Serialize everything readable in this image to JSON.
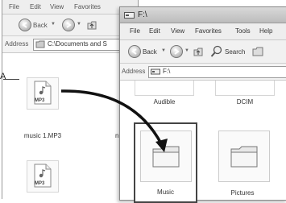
{
  "back_window": {
    "menu": [
      "File",
      "Edit",
      "View",
      "Favorites"
    ],
    "toolbar": {
      "back_label": "Back"
    },
    "address": {
      "label": "Address",
      "value": "C:\\Documents and S"
    },
    "files": [
      {
        "name": "music 1.MP3",
        "badge": "MP3"
      },
      {
        "name": "",
        "badge": "MP3"
      }
    ],
    "cut_letter": "n"
  },
  "front_window": {
    "title": "F:\\",
    "menu": [
      "File",
      "Edit",
      "View",
      "Favorites",
      "Tools",
      "Help"
    ],
    "toolbar": {
      "back_label": "Back",
      "search_label": "Search"
    },
    "address": {
      "label": "Address",
      "value": "F:\\"
    },
    "folders": [
      "Audible",
      "DCIM",
      "Music",
      "Pictures"
    ]
  },
  "callout": {
    "letter": "A"
  }
}
